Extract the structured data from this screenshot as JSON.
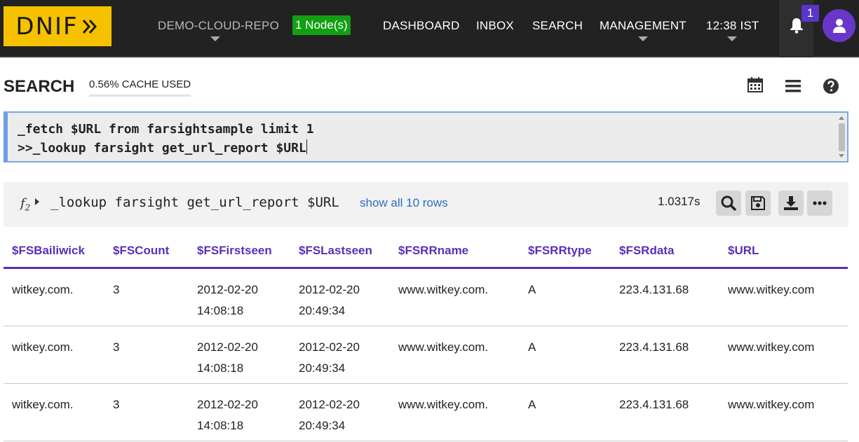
{
  "logo": {
    "text": "DNIF"
  },
  "nav": {
    "repo": "DEMO-CLOUD-REPO",
    "nodes": "1 Node(s)",
    "dashboard": "DASHBOARD",
    "inbox": "INBOX",
    "search": "SEARCH",
    "management": "MANAGEMENT",
    "time": "12:38 IST",
    "notification_count": "1"
  },
  "search_header": {
    "title": "SEARCH",
    "cache": "0.56% CACHE USED",
    "icons": [
      "calendar-icon",
      "menu-icon",
      "help-icon"
    ]
  },
  "query": {
    "line1": "_fetch $URL from farsightsample limit 1",
    "line2": ">>_lookup farsight get_url_report $URL"
  },
  "result": {
    "fn_label": "f",
    "fn_sub": "2",
    "query": "_lookup farsight get_url_report $URL",
    "show_all": "show all 10 rows",
    "elapsed": "1.0317s",
    "buttons": [
      "search-icon",
      "save-icon",
      "download-icon",
      "more-icon"
    ]
  },
  "table": {
    "columns": [
      "$FSBailiwick",
      "$FSCount",
      "$FSFirstseen",
      "$FSLastseen",
      "$FSRRname",
      "$FSRRtype",
      "$FSRdata",
      "$URL"
    ],
    "rows": [
      [
        "witkey.com.",
        "3",
        "2012-02-20 14:08:18",
        "2012-02-20 20:49:34",
        "www.witkey.com.",
        "A",
        "223.4.131.68",
        "www.witkey.com"
      ],
      [
        "witkey.com.",
        "3",
        "2012-02-20 14:08:18",
        "2012-02-20 20:49:34",
        "www.witkey.com.",
        "A",
        "223.4.131.68",
        "www.witkey.com"
      ],
      [
        "witkey.com.",
        "3",
        "2012-02-20 14:08:18",
        "2012-02-20 20:49:34",
        "www.witkey.com.",
        "A",
        "223.4.131.68",
        "www.witkey.com"
      ]
    ]
  },
  "colors": {
    "topbar": "#222222",
    "logo": "#f6c200",
    "node_badge": "#12a012",
    "accent_purple": "#5a2fb8",
    "link": "#2d6fc0"
  }
}
